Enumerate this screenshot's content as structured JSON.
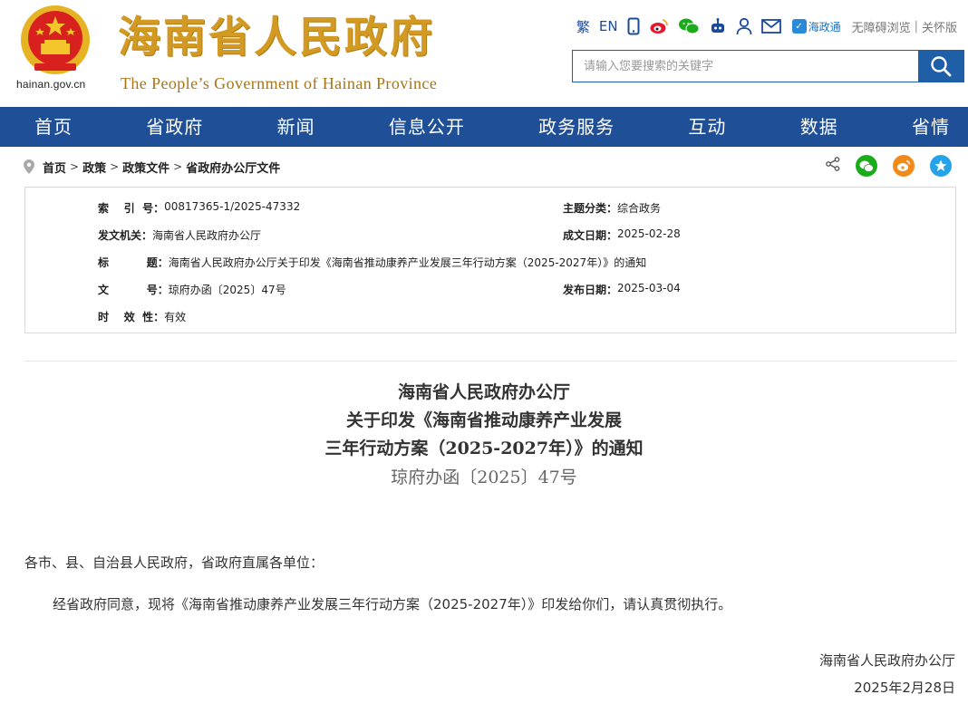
{
  "header": {
    "emblem_url": "hainan.gov.cn",
    "title": "海南省人民政府",
    "subtitle": "The People’s Government  of Hainan Province",
    "toolbar": {
      "traditional": "繁",
      "english": "EN",
      "haizhengtong": "海政通",
      "accessibility": "无障碍浏览",
      "divider": "|",
      "elderly": "关怀版"
    },
    "search_placeholder": "请输入您要搜索的关键字"
  },
  "nav": {
    "items": [
      "首页",
      "省政府",
      "新闻",
      "信息公开",
      "政务服务",
      "互动",
      "数据",
      "省情"
    ]
  },
  "breadcrumb": {
    "items": [
      "首页",
      "政策",
      "政策文件",
      "省政府办公厅文件"
    ],
    "separator": ">"
  },
  "meta": {
    "index_key": "索    引  号：",
    "index_val": "00817365-1/2025-47332",
    "category_key": "主题分类：",
    "category_val": "综合政务",
    "issuer_key": "发文机关：",
    "issuer_val": "海南省人民政府办公厅",
    "created_key": "成文日期：",
    "created_val": "2025-02-28",
    "title_key": "标          题：",
    "title_val": "海南省人民政府办公厅关于印发《海南省推动康养产业发展三年行动方案（2025-2027年）》的通知",
    "docno_key": "文          号：",
    "docno_val": "琼府办函〔2025〕47号",
    "published_key": "发布日期：",
    "published_val": "2025-03-04",
    "validity_key": "时    效  性：",
    "validity_val": "有效"
  },
  "article": {
    "title_line1": "海南省人民政府办公厅",
    "title_line2": "关于印发《海南省推动康养产业发展",
    "title_line3": "三年行动方案（2025-2027年）》的通知",
    "doc_number": "琼府办函〔2025〕47号",
    "salutation": "各市、县、自治县人民政府，省政府直属各单位：",
    "body": "经省政府同意，现将《海南省推动康养产业发展三年行动方案（2025-2027年）》印发给你们，请认真贯彻执行。",
    "signer": "海南省人民政府办公厅",
    "date": "2025年2月28日"
  },
  "colors": {
    "nav_blue": "#1f4f96",
    "title_gold": "#d29a22",
    "wechat_green": "#1aad19",
    "weibo_orange": "#f28a1b",
    "qzone_blue": "#26a3e8"
  }
}
